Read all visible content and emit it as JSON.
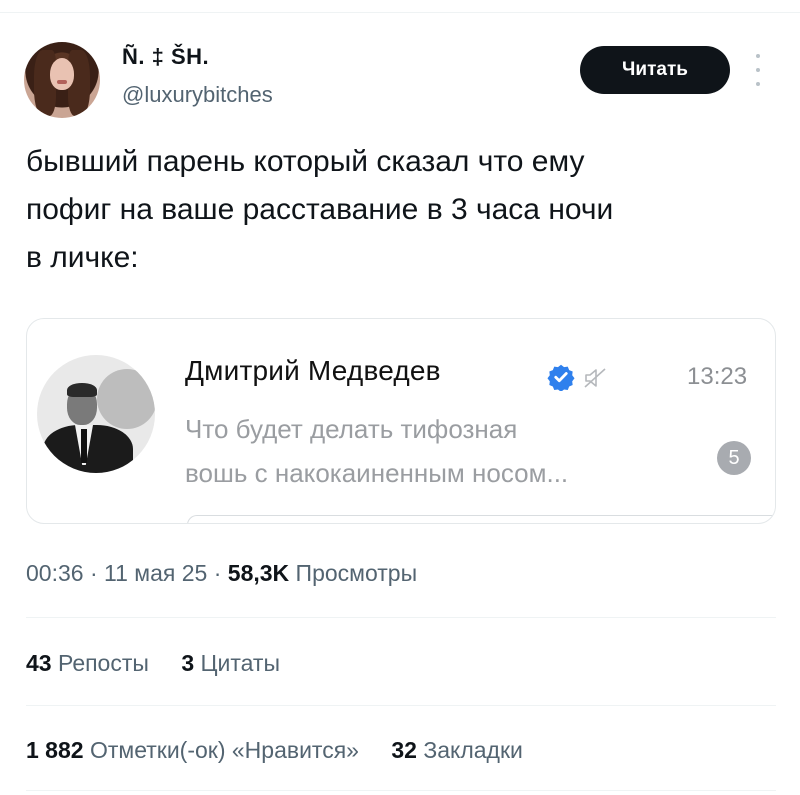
{
  "author": {
    "display_name": "Ñ. ‡ ŠH.",
    "handle": "@luxurybitches"
  },
  "follow_button": {
    "label": "Читать"
  },
  "tweet": {
    "text_line1": "бывший парень который сказал что ему",
    "text_line2": "пофиг на ваше расставание в 3 часа ночи",
    "text_line3": "в личке:"
  },
  "dm_preview": {
    "name": "Дмитрий Медведев",
    "time": "13:23",
    "message_line1": "Что будет делать тифозная",
    "message_line2": "вошь с накокаиненным носом...",
    "unread_count": "5",
    "verified_color": "#2f80ed"
  },
  "meta": {
    "time": "00:36",
    "date": "11 мая 25",
    "views_count": "58,3K",
    "views_label": "Просмотры"
  },
  "stats": {
    "reposts_count": "43",
    "reposts_label": "Репосты",
    "quotes_count": "3",
    "quotes_label": "Цитаты",
    "likes_count": "1 882",
    "likes_label": "Отметки(-ок) «Нравится»",
    "bookmarks_count": "32",
    "bookmarks_label": "Закладки"
  }
}
